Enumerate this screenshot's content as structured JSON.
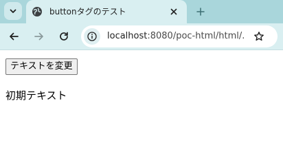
{
  "tab": {
    "title": "buttonタグのテスト",
    "favicon_icon": "globe-icon",
    "close_icon": "close-icon"
  },
  "tabbar": {
    "tab_list_icon": "chevron-down-icon",
    "new_tab_icon": "plus-icon"
  },
  "toolbar": {
    "back_icon": "arrow-left-icon",
    "forward_icon": "arrow-right-icon",
    "reload_icon": "reload-icon",
    "site_info_icon": "site-info-icon",
    "url_host": "localhost",
    "url_rest": ":8080/poc-html/html/...",
    "bookmark_icon": "star-icon"
  },
  "page": {
    "button_label": "テキストを変更",
    "text": "初期テキスト"
  },
  "colors": {
    "tabbar_bg": "#a9d6db",
    "toolbar_bg": "#d9eff1"
  }
}
